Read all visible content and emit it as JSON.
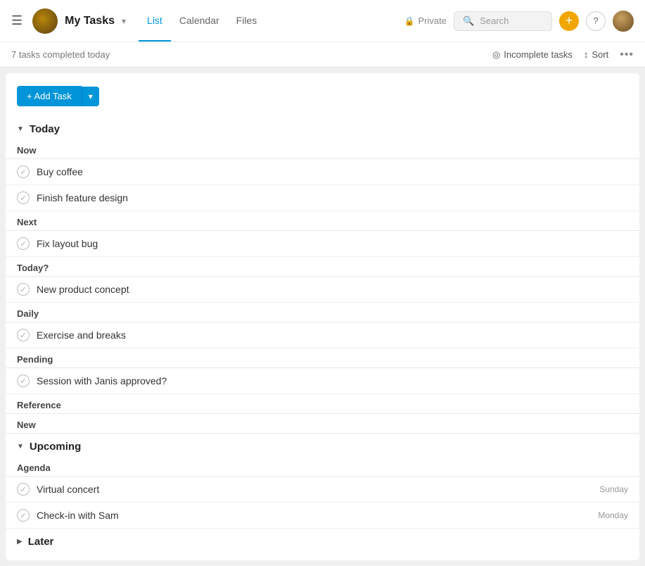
{
  "header": {
    "hamburger_icon": "☰",
    "app_title": "My Tasks",
    "dropdown_icon": "▾",
    "nav_tabs": [
      {
        "label": "List",
        "active": true
      },
      {
        "label": "Calendar",
        "active": false
      },
      {
        "label": "Files",
        "active": false
      }
    ],
    "private_label": "Private",
    "search_placeholder": "Search",
    "plus_icon": "+",
    "help_icon": "?"
  },
  "subheader": {
    "tasks_completed": "7 tasks completed today",
    "incomplete_tasks_label": "Incomplete tasks",
    "sort_label": "Sort",
    "more_icon": "•••"
  },
  "toolbar": {
    "add_task_label": "+ Add Task",
    "dropdown_arrow": "▾"
  },
  "sections": [
    {
      "type": "collapsible",
      "arrow": "▼",
      "title": "Today",
      "subsections": [
        {
          "label": "Now",
          "tasks": [
            {
              "name": "Buy coffee",
              "date": ""
            },
            {
              "name": "Finish feature design",
              "date": ""
            }
          ]
        },
        {
          "label": "Next",
          "tasks": [
            {
              "name": "Fix layout bug",
              "date": ""
            }
          ]
        },
        {
          "label": "Today?",
          "tasks": [
            {
              "name": "New product concept",
              "date": ""
            }
          ]
        },
        {
          "label": "Daily",
          "tasks": [
            {
              "name": "Exercise and breaks",
              "date": ""
            }
          ]
        },
        {
          "label": "Pending",
          "tasks": [
            {
              "name": "Session with Janis approved?",
              "date": ""
            }
          ]
        },
        {
          "label": "Reference",
          "tasks": []
        },
        {
          "label": "New",
          "tasks": []
        }
      ]
    },
    {
      "type": "collapsible",
      "arrow": "▼",
      "title": "Upcoming",
      "subsections": [
        {
          "label": "Agenda",
          "tasks": [
            {
              "name": "Virtual concert",
              "date": "Sunday"
            },
            {
              "name": "Check-in with Sam",
              "date": "Monday"
            }
          ]
        }
      ]
    },
    {
      "type": "collapsible",
      "arrow": "▶",
      "title": "Later",
      "subsections": []
    }
  ]
}
